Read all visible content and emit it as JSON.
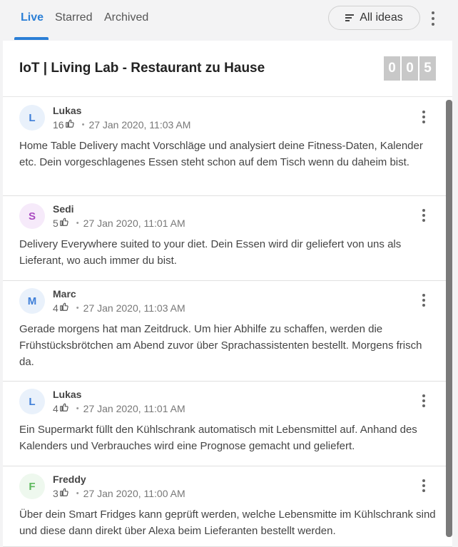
{
  "tabs": [
    {
      "label": "Live",
      "active": true
    },
    {
      "label": "Starred",
      "active": false
    },
    {
      "label": "Archived",
      "active": false
    }
  ],
  "filter": {
    "label": "All ideas",
    "icon": "filter-lines-icon"
  },
  "board": {
    "title": "IoT | Living Lab - Restaurant zu Hause",
    "counter_digits": [
      "0",
      "0",
      "5"
    ]
  },
  "ideas": [
    {
      "initial": "L",
      "author": "Lukas",
      "likes": "16",
      "time": "27 Jan 2020, 11:03 AM",
      "avatar_color": "#3f7fd8",
      "avatar_bg": "#e9f1fb",
      "text": "Home Table Delivery macht Vorschläge und analysiert deine Fitness-Daten, Kalender etc. Dein vorgeschlagenes Essen steht schon auf dem Tisch wenn du daheim bist."
    },
    {
      "initial": "S",
      "author": "Sedi",
      "likes": "5",
      "time": "27 Jan 2020, 11:01 AM",
      "avatar_color": "#a94ac0",
      "avatar_bg": "#f6eafa",
      "text": "Delivery Everywhere suited to your diet. Dein Essen wird dir geliefert von uns als Lieferant, wo auch immer du bist."
    },
    {
      "initial": "M",
      "author": "Marc",
      "likes": "4",
      "time": "27 Jan 2020, 11:03 AM",
      "avatar_color": "#3f7fd8",
      "avatar_bg": "#e9f1fb",
      "text": "Gerade morgens hat man Zeitdruck. Um hier Abhilfe zu schaffen, werden die Frühstücksbrötchen am Abend zuvor über Sprachassistenten bestellt. Morgens frisch da."
    },
    {
      "initial": "L",
      "author": "Lukas",
      "likes": "4",
      "time": "27 Jan 2020, 11:01 AM",
      "avatar_color": "#3f7fd8",
      "avatar_bg": "#e9f1fb",
      "text": "Ein Supermarkt füllt den Kühlschrank automatisch mit Lebensmittel auf. Anhand des Kalenders und Verbrauches wird eine Prognose gemacht und geliefert."
    },
    {
      "initial": "F",
      "author": "Freddy",
      "likes": "3",
      "time": "27 Jan 2020, 11:00 AM",
      "avatar_color": "#5cb85c",
      "avatar_bg": "#eef8ee",
      "text": "Über dein Smart Fridges kann geprüft werden, welche Lebensmitte im Kühlschrank sind und diese dann direkt über Alexa beim Lieferanten bestellt werden."
    }
  ],
  "colors": {
    "accent": "#2b7fd6",
    "counter_bg": "#c8c8c8"
  },
  "icons": {
    "like": "thumbs-up-icon",
    "menu": "kebab-menu-icon"
  }
}
